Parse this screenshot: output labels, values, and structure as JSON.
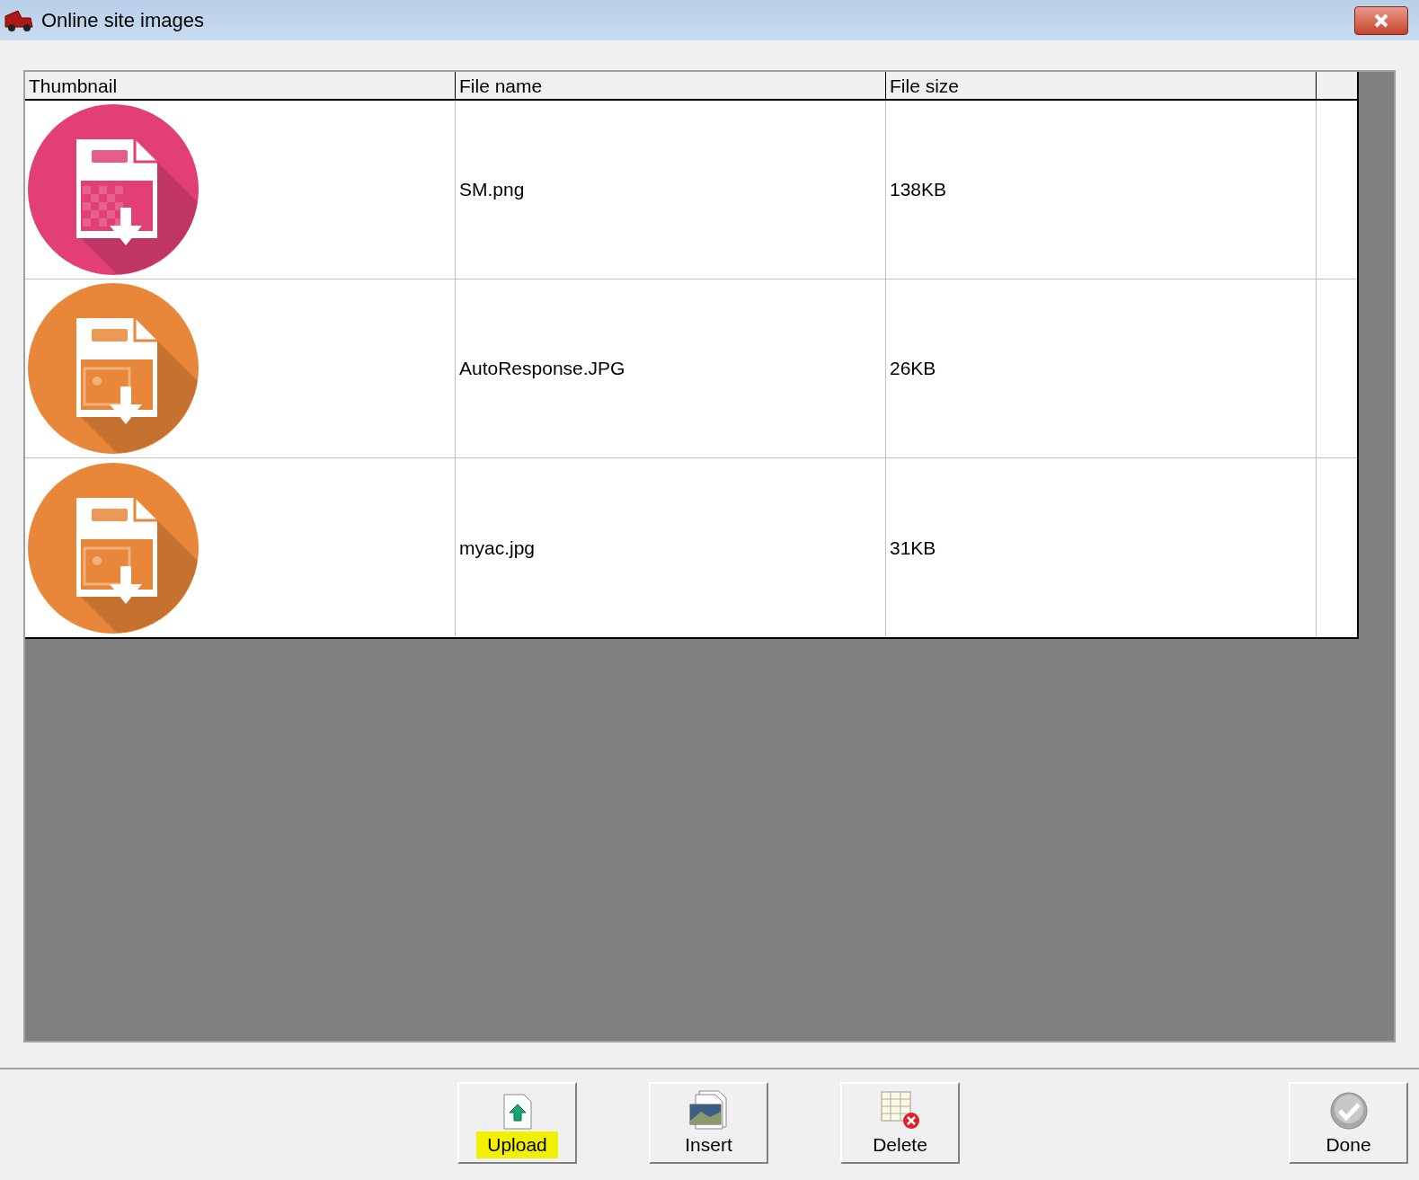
{
  "window": {
    "title": "Online site images"
  },
  "table": {
    "columns": [
      "Thumbnail",
      "File name",
      "File size"
    ],
    "rows": [
      {
        "color": "#e23f76",
        "file_name": "SM.png",
        "file_size": "138KB",
        "kind": "checker"
      },
      {
        "color": "#e8873a",
        "file_name": "AutoResponse.JPG",
        "file_size": "26KB",
        "kind": "picture"
      },
      {
        "color": "#e8873a",
        "file_name": "myac.jpg",
        "file_size": "31KB",
        "kind": "picture"
      }
    ]
  },
  "buttons": [
    {
      "kind": "upload",
      "label": "Upload",
      "highlighted": true
    },
    {
      "kind": "insert",
      "label": "Insert",
      "highlighted": false
    },
    {
      "kind": "delete",
      "label": "Delete",
      "highlighted": false
    },
    {
      "kind": "done",
      "label": "Done",
      "highlighted": false
    }
  ]
}
